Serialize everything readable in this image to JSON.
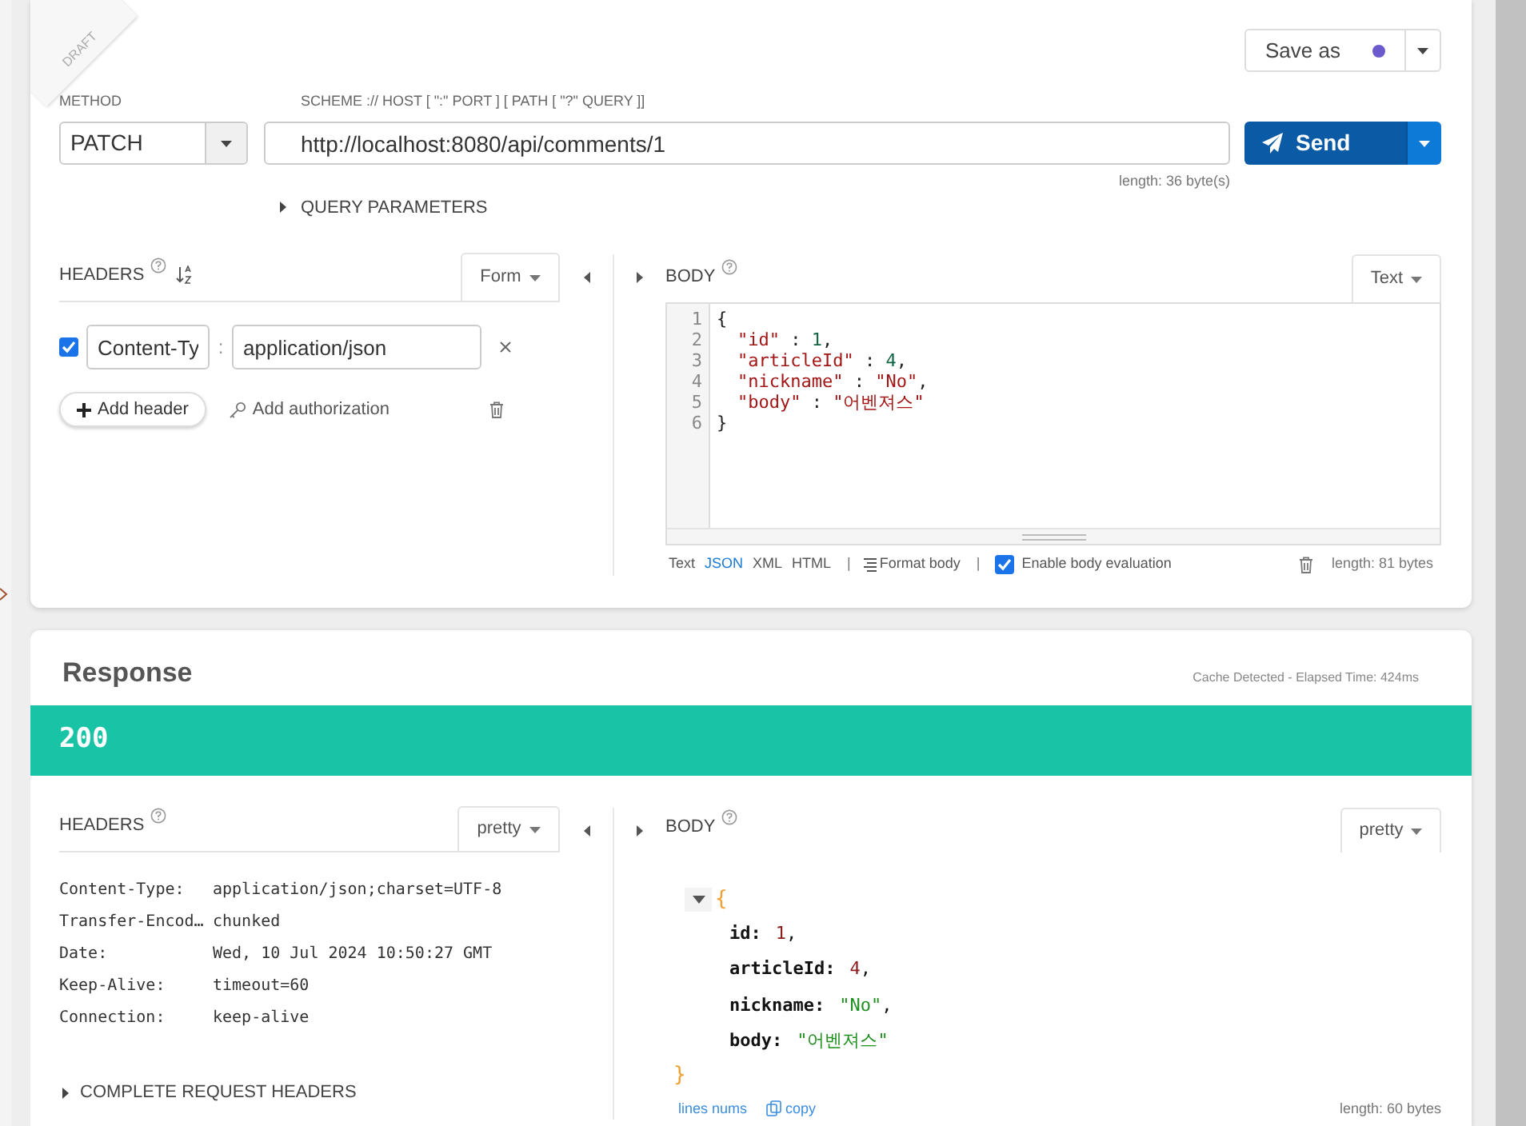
{
  "draft_label": "DRAFT",
  "save": {
    "label": "Save as"
  },
  "request": {
    "method_label": "METHOD",
    "method": "PATCH",
    "url_label": "SCHEME :// HOST [ \":\" PORT ] [ PATH [ \"?\" QUERY ]]",
    "url": "http://localhost:8080/api/comments/1",
    "url_length": "length: 36 byte(s)",
    "send_label": "Send",
    "query_parameters": {
      "label": "QUERY PARAMETERS",
      "expanded": false
    }
  },
  "request_headers": {
    "title": "HEADERS",
    "mode": "Form",
    "rows": [
      {
        "enabled": true,
        "name": "Content-Ty",
        "separator": ":",
        "value": "application/json"
      }
    ],
    "add_header": "Add header",
    "add_authorization": "Add authorization"
  },
  "request_body": {
    "title": "BODY",
    "mode": "Text",
    "lines": [
      {
        "number": "1",
        "tokens": [
          {
            "kind": "punct",
            "text": "{"
          }
        ],
        "children": [
          {
            "number": "2",
            "tokens": [
              {
                "kind": "key",
                "text": "\"id\""
              },
              {
                "kind": "punct",
                "text": " : "
              },
              {
                "kind": "number",
                "text": "1"
              },
              {
                "kind": "punct",
                "text": ","
              }
            ]
          },
          {
            "number": "3",
            "tokens": [
              {
                "kind": "key",
                "text": "\"articleId\""
              },
              {
                "kind": "punct",
                "text": " : "
              },
              {
                "kind": "number",
                "text": "4"
              },
              {
                "kind": "punct",
                "text": ","
              }
            ]
          },
          {
            "number": "4",
            "tokens": [
              {
                "kind": "key",
                "text": "\"nickname\""
              },
              {
                "kind": "punct",
                "text": " : "
              },
              {
                "kind": "key",
                "text": "\"No\""
              },
              {
                "kind": "punct",
                "text": ","
              }
            ]
          },
          {
            "number": "5",
            "tokens": [
              {
                "kind": "key",
                "text": "\"body\""
              },
              {
                "kind": "punct",
                "text": " : "
              },
              {
                "kind": "key",
                "text": "\"어벤져스\""
              }
            ]
          }
        ]
      },
      {
        "number": "6",
        "tokens": [
          {
            "kind": "punct",
            "text": "}"
          }
        ]
      }
    ],
    "formats": [
      {
        "label": "Text",
        "selected": false
      },
      {
        "label": "JSON",
        "selected": true
      },
      {
        "label": "XML",
        "selected": false
      },
      {
        "label": "HTML",
        "selected": false
      }
    ],
    "separator": "|",
    "format_body": "Format body",
    "evaluation": {
      "label": "Enable body evaluation",
      "checked": true
    },
    "length": "length: 81 bytes"
  },
  "response": {
    "title": "Response",
    "timing": "Cache Detected - Elapsed Time: 424ms",
    "status": "200",
    "headers": {
      "title": "HEADERS",
      "mode": "pretty",
      "rows": [
        {
          "name": "Content-Type:",
          "value": "application/json;charset=UTF-8"
        },
        {
          "name": "Transfer-Encod…",
          "value": "chunked"
        },
        {
          "name": "Date:",
          "value": "Wed, 10 Jul 2024 10:50:27 GMT"
        },
        {
          "name": "Keep-Alive:",
          "value": "timeout=60"
        },
        {
          "name": "Connection:",
          "value": "keep-alive"
        }
      ],
      "complete_request_headers": {
        "label": "COMPLETE REQUEST HEADERS",
        "expanded": false
      }
    },
    "body": {
      "title": "BODY",
      "mode": "pretty",
      "expanded": true,
      "open_brace": "{",
      "close_brace": "}",
      "fields": [
        {
          "key": "id:",
          "value": "1",
          "kind": "number",
          "comma": ","
        },
        {
          "key": "articleId:",
          "value": "4",
          "kind": "number",
          "comma": ","
        },
        {
          "key": "nickname:",
          "value": "\"No\"",
          "kind": "string",
          "comma": ","
        },
        {
          "key": "body:",
          "value": "\"어벤져스\"",
          "kind": "string"
        }
      ],
      "lines_nums": "lines nums",
      "copy": "copy",
      "length": "length: 60 bytes"
    }
  }
}
